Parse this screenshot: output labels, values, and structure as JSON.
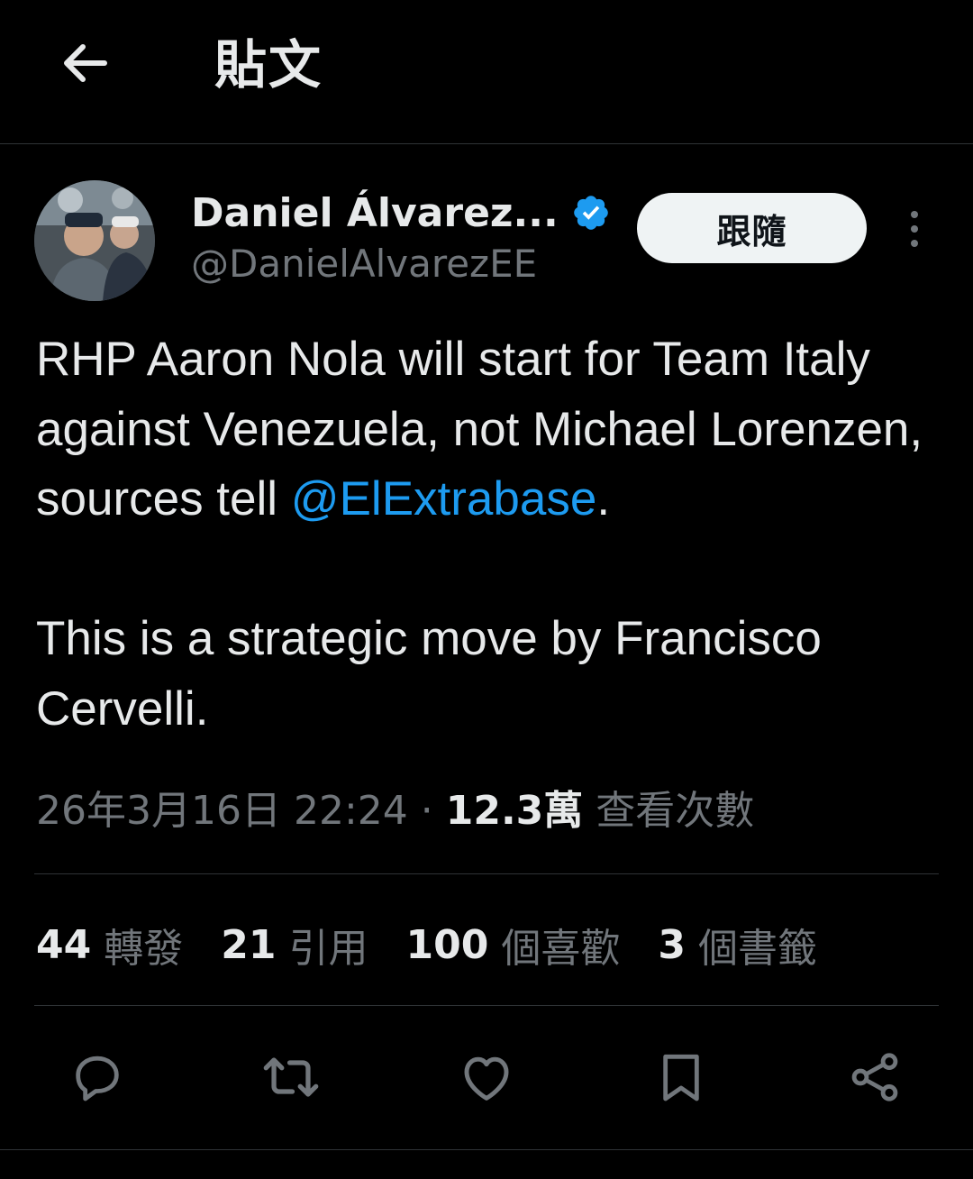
{
  "header": {
    "back_icon": "arrow-left-icon",
    "title": "貼文"
  },
  "author": {
    "display_name": "Daniel Álvarez...",
    "handle": "@DanielAlvarezEE",
    "verified_icon": "verified-badge-icon",
    "follow_label": "跟隨",
    "more_icon": "more-vertical-icon"
  },
  "tweet": {
    "paragraph1_before": "RHP Aaron Nola will start for Team Italy against Venezuela, not Michael Lorenzen, sources tell ",
    "mention": "@ElExtrabase",
    "paragraph1_after": ".",
    "paragraph2": "This is a strategic move by Francisco Cervelli."
  },
  "meta": {
    "timestamp": "26年3月16日 22:24",
    "separator": " · ",
    "views_count": "12.3萬",
    "views_label": "查看次數"
  },
  "stats": [
    {
      "count": "44",
      "label": "轉發"
    },
    {
      "count": "21",
      "label": "引用"
    },
    {
      "count": "100",
      "label": "個喜歡"
    },
    {
      "count": "3",
      "label": "個書籤"
    }
  ],
  "actions": [
    {
      "icon": "reply-icon"
    },
    {
      "icon": "retweet-icon"
    },
    {
      "icon": "like-icon"
    },
    {
      "icon": "bookmark-icon"
    },
    {
      "icon": "share-icon"
    }
  ],
  "colors": {
    "background": "#000000",
    "text": "#e7e9ea",
    "secondary": "#71767b",
    "accent": "#1d9bf0",
    "divider": "#2f3336"
  }
}
